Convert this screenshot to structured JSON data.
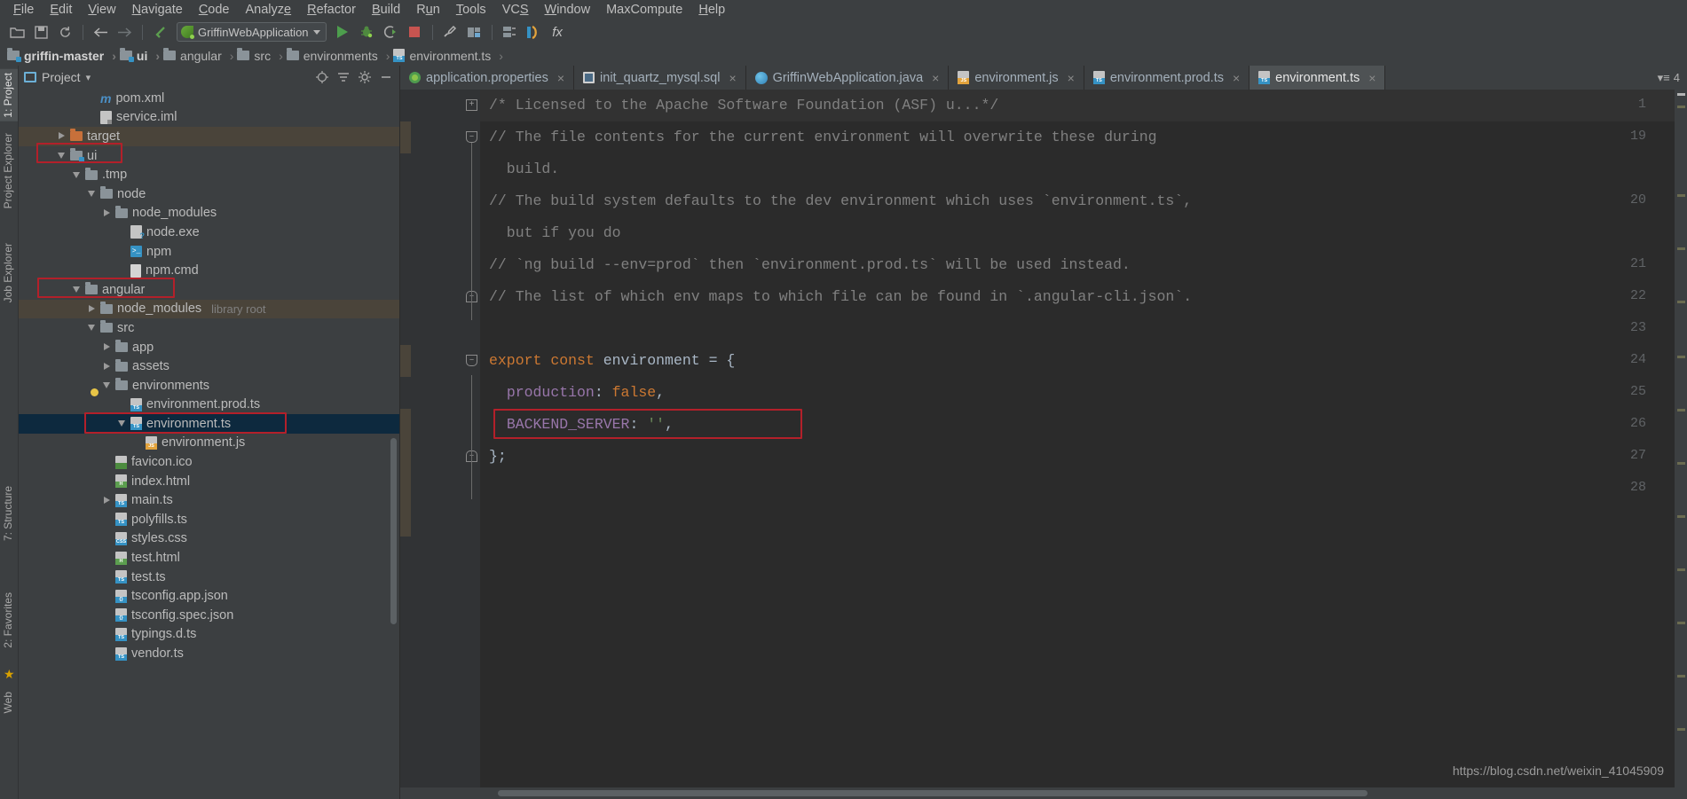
{
  "menubar": {
    "items": [
      "File",
      "Edit",
      "View",
      "Navigate",
      "Code",
      "Analyze",
      "Refactor",
      "Build",
      "Run",
      "Tools",
      "VCS",
      "Window",
      "MaxCompute",
      "Help"
    ]
  },
  "toolbar": {
    "open_label": "open-folder-icon",
    "save_label": "save-icon",
    "sync_label": "sync-icon",
    "back_label": "back-arrow-icon",
    "forward_label": "forward-arrow-icon",
    "run_config_name": "GriffinWebApplication",
    "run_label": "run-icon",
    "debug_label": "debug-icon",
    "coverage_label": "run-with-coverage-icon",
    "stop_label": "stop-icon",
    "wrench_label": "settings-wrench-icon",
    "project_structure_label": "project-structure-icon",
    "fx_label": "fx"
  },
  "breadcrumb": {
    "items": [
      {
        "label": "griffin-master",
        "icon": "module-folder-icon",
        "bold": true
      },
      {
        "label": "ui",
        "icon": "module-folder-icon",
        "bold": true
      },
      {
        "label": "angular",
        "icon": "folder-icon",
        "bold": false
      },
      {
        "label": "src",
        "icon": "folder-icon",
        "bold": false
      },
      {
        "label": "environments",
        "icon": "folder-icon",
        "bold": false
      },
      {
        "label": "environment.ts",
        "icon": "ts-file-icon",
        "bold": false
      }
    ]
  },
  "left_rail": {
    "items": [
      "1: Project",
      "Project Explorer",
      "Job Explorer"
    ],
    "bottom_items": [
      "7: Structure",
      "2: Favorites"
    ],
    "web_label": "Web"
  },
  "project_panel": {
    "title": "Project",
    "dropdown_caret": "▾",
    "tree": [
      {
        "label": "pom.xml",
        "indent": 4,
        "arrow": "none",
        "icon": "maven-m-icon",
        "state": "normal"
      },
      {
        "label": "service.iml",
        "indent": 4,
        "arrow": "none",
        "icon": "iml-file-icon",
        "state": "normal"
      },
      {
        "label": "target",
        "indent": 2,
        "arrow": "right",
        "icon": "folder-orange-icon",
        "state": "hover"
      },
      {
        "label": "ui",
        "indent": 2,
        "arrow": "down",
        "icon": "module-folder-icon",
        "state": "normal"
      },
      {
        "label": ".tmp",
        "indent": 3,
        "arrow": "down",
        "icon": "folder-icon",
        "state": "normal"
      },
      {
        "label": "node",
        "indent": 4,
        "arrow": "down",
        "icon": "folder-icon",
        "state": "normal"
      },
      {
        "label": "node_modules",
        "indent": 5,
        "arrow": "right",
        "icon": "folder-icon",
        "state": "normal"
      },
      {
        "label": "node.exe",
        "indent": 6,
        "arrow": "none",
        "icon": "exe-file-icon",
        "state": "normal"
      },
      {
        "label": "npm",
        "indent": 6,
        "arrow": "none",
        "icon": "npm-terminal-icon",
        "state": "normal"
      },
      {
        "label": "npm.cmd",
        "indent": 6,
        "arrow": "none",
        "icon": "cmd-file-icon",
        "state": "normal"
      },
      {
        "label": "angular",
        "indent": 3,
        "arrow": "down",
        "icon": "folder-icon",
        "state": "normal"
      },
      {
        "label": "node_modules",
        "indent": 4,
        "arrow": "right",
        "icon": "folder-icon",
        "state": "hover",
        "suffix": "library root"
      },
      {
        "label": "src",
        "indent": 4,
        "arrow": "down",
        "icon": "folder-icon",
        "state": "normal"
      },
      {
        "label": "app",
        "indent": 5,
        "arrow": "right",
        "icon": "folder-icon",
        "state": "normal"
      },
      {
        "label": "assets",
        "indent": 5,
        "arrow": "right",
        "icon": "folder-icon",
        "state": "normal"
      },
      {
        "label": "environments",
        "indent": 5,
        "arrow": "down",
        "icon": "folder-icon",
        "state": "normal"
      },
      {
        "label": "environment.prod.ts",
        "indent": 6,
        "arrow": "none",
        "icon": "ts-file-icon",
        "state": "normal"
      },
      {
        "label": "environment.ts",
        "indent": 6,
        "arrow": "down",
        "icon": "ts-file-icon",
        "state": "selected"
      },
      {
        "label": "environment.js",
        "indent": 7,
        "arrow": "none",
        "icon": "js-file-icon",
        "state": "normal"
      },
      {
        "label": "favicon.ico",
        "indent": 5,
        "arrow": "none",
        "icon": "image-file-icon",
        "state": "normal"
      },
      {
        "label": "index.html",
        "indent": 5,
        "arrow": "none",
        "icon": "html-file-icon",
        "state": "normal"
      },
      {
        "label": "main.ts",
        "indent": 5,
        "arrow": "right",
        "icon": "ts-file-icon",
        "state": "normal"
      },
      {
        "label": "polyfills.ts",
        "indent": 5,
        "arrow": "none",
        "icon": "ts-file-icon",
        "state": "normal"
      },
      {
        "label": "styles.css",
        "indent": 5,
        "arrow": "none",
        "icon": "css-file-icon",
        "state": "normal"
      },
      {
        "label": "test.html",
        "indent": 5,
        "arrow": "none",
        "icon": "html-file-icon",
        "state": "normal"
      },
      {
        "label": "test.ts",
        "indent": 5,
        "arrow": "none",
        "icon": "ts-file-icon",
        "state": "normal"
      },
      {
        "label": "tsconfig.app.json",
        "indent": 5,
        "arrow": "none",
        "icon": "json-file-icon",
        "state": "normal"
      },
      {
        "label": "tsconfig.spec.json",
        "indent": 5,
        "arrow": "none",
        "icon": "json-file-icon",
        "state": "normal"
      },
      {
        "label": "typings.d.ts",
        "indent": 5,
        "arrow": "none",
        "icon": "ts-file-icon",
        "state": "normal"
      },
      {
        "label": "vendor.ts",
        "indent": 5,
        "arrow": "none",
        "icon": "ts-file-icon",
        "state": "normal"
      }
    ]
  },
  "editor_tabs": {
    "tabs": [
      {
        "label": "application.properties",
        "icon": "properties-file-icon",
        "active": false
      },
      {
        "label": "init_quartz_mysql.sql",
        "icon": "sql-file-icon",
        "active": false
      },
      {
        "label": "GriffinWebApplication.java",
        "icon": "java-class-icon",
        "active": false
      },
      {
        "label": "environment.js",
        "icon": "js-file-icon",
        "active": false
      },
      {
        "label": "environment.prod.ts",
        "icon": "ts-file-icon",
        "active": false
      },
      {
        "label": "environment.ts",
        "icon": "ts-file-icon",
        "active": true
      }
    ],
    "close_glyph": "×",
    "tab_count": "4",
    "tab_list_glyph": "▾≡"
  },
  "code": {
    "lines": [
      {
        "no": "1",
        "text": "/* Licensed to the Apache Software Foundation (ASF) u...*/",
        "cls": "comment",
        "fold": "plus",
        "highlight": true
      },
      {
        "no": "19",
        "text": "// The file contents for the current environment will overwrite these during",
        "cls": "comment",
        "fold": "minus"
      },
      {
        "no": "",
        "text": "  build.",
        "cls": "comment",
        "fold": "none"
      },
      {
        "no": "20",
        "text": "// The build system defaults to the dev environment which uses `environment.ts`,",
        "cls": "comment",
        "fold": "none"
      },
      {
        "no": "",
        "text": "  but if you do",
        "cls": "comment",
        "fold": "none"
      },
      {
        "no": "21",
        "text": "// `ng build --env=prod` then `environment.prod.ts` will be used instead.",
        "cls": "comment",
        "fold": "none"
      },
      {
        "no": "22",
        "text": "// The list of which env maps to which file can be found in `.angular-cli.json`.",
        "cls": "comment",
        "fold": "minus-top"
      },
      {
        "no": "23",
        "text": "",
        "cls": "plain",
        "fold": "none"
      },
      {
        "no": "24",
        "text": "export const environment = {",
        "cls": "mixed-export",
        "fold": "minus"
      },
      {
        "no": "25",
        "text": "  production: false,",
        "cls": "mixed-production",
        "fold": "none",
        "bulb": true
      },
      {
        "no": "26",
        "text": "  BACKEND_SERVER: '',",
        "cls": "mixed-backend",
        "fold": "none",
        "redbox": true
      },
      {
        "no": "27",
        "text": "};",
        "cls": "plain",
        "fold": "minus-end"
      },
      {
        "no": "28",
        "text": "",
        "cls": "plain",
        "fold": "none"
      }
    ],
    "tokens": {
      "export_kw": "export",
      "const_kw": "const",
      "env_name": "environment",
      "eq_brace": "= {",
      "production_key": "production",
      "false_val": "false",
      "backend_key": "BACKEND_SERVER",
      "empty_string": "''",
      "close_brace": "};"
    }
  },
  "annotations": {
    "box_color": "#b3202a",
    "boxes": [
      "ui-tree-node",
      "angular-tree-node",
      "environment-ts-tree-node",
      "backend-server-code-line"
    ]
  },
  "watermark": {
    "text": "https://blog.csdn.net/weixin_41045909"
  }
}
